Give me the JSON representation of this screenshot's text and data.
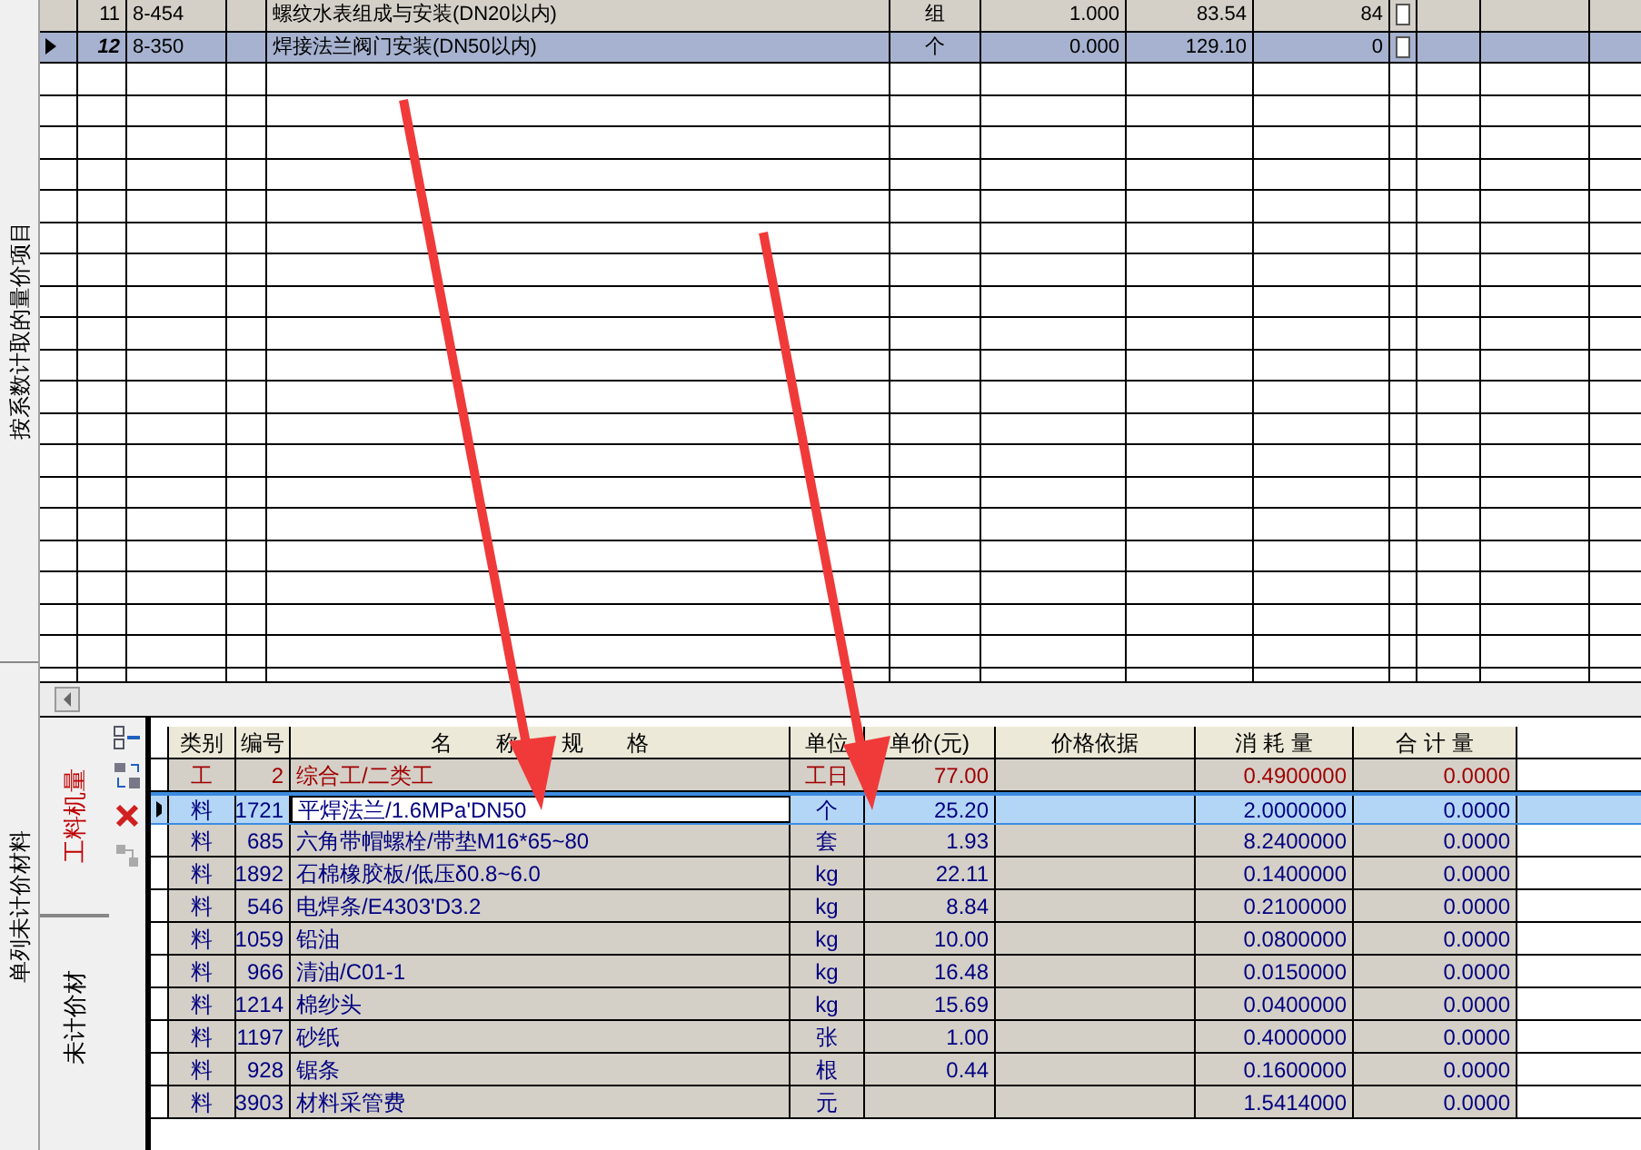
{
  "side_tabs": [
    {
      "label": "按系数计取的量价项目",
      "selected": false
    },
    {
      "label": "单列未计价材料",
      "selected": false
    }
  ],
  "top_grid": {
    "rows": [
      {
        "num": "11",
        "code": "8-454",
        "name": "螺纹水表组成与安装(DN20以内)",
        "unit": "组",
        "quantity": "1.000",
        "price": "83.54",
        "total": "84",
        "checked": false,
        "selected": false
      },
      {
        "num": "12",
        "code": "8-350",
        "name": "焊接法兰阀门安装(DN50以内)",
        "unit": "个",
        "quantity": "0.000",
        "price": "129.10",
        "total": "0",
        "checked": false,
        "selected": true
      }
    ]
  },
  "bottom_tabs": [
    {
      "label": "工料机量",
      "selected": true
    },
    {
      "label": "未计价材",
      "selected": false
    }
  ],
  "bottom_grid": {
    "columns": [
      "类别",
      "编号",
      "名　　称　　规　　格",
      "单位",
      "单价(元)",
      "价格依据",
      "消 耗 量",
      "合 计 量"
    ],
    "rows": [
      {
        "kind": "labor",
        "type": "工",
        "code": "2",
        "name": "综合工/二类工",
        "unit": "工日",
        "price": "77.00",
        "consumption": "0.4900000",
        "total": "0.0000",
        "selected": false
      },
      {
        "kind": "material",
        "type": "料",
        "code": "1721",
        "name": "平焊法兰/1.6MPa'DN50",
        "unit": "个",
        "price": "25.20",
        "consumption": "2.0000000",
        "total": "0.0000",
        "selected": true
      },
      {
        "kind": "material",
        "type": "料",
        "code": "685",
        "name": "六角带帽螺栓/带垫M16*65~80",
        "unit": "套",
        "price": "1.93",
        "consumption": "8.2400000",
        "total": "0.0000",
        "selected": false
      },
      {
        "kind": "material",
        "type": "料",
        "code": "1892",
        "name": "石棉橡胶板/低压δ0.8~6.0",
        "unit": "kg",
        "price": "22.11",
        "consumption": "0.1400000",
        "total": "0.0000",
        "selected": false
      },
      {
        "kind": "material",
        "type": "料",
        "code": "546",
        "name": "电焊条/E4303'D3.2",
        "unit": "kg",
        "price": "8.84",
        "consumption": "0.2100000",
        "total": "0.0000",
        "selected": false
      },
      {
        "kind": "material",
        "type": "料",
        "code": "1059",
        "name": "铅油",
        "unit": "kg",
        "price": "10.00",
        "consumption": "0.0800000",
        "total": "0.0000",
        "selected": false
      },
      {
        "kind": "material",
        "type": "料",
        "code": "966",
        "name": "清油/C01-1",
        "unit": "kg",
        "price": "16.48",
        "consumption": "0.0150000",
        "total": "0.0000",
        "selected": false
      },
      {
        "kind": "material",
        "type": "料",
        "code": "1214",
        "name": "棉纱头",
        "unit": "kg",
        "price": "15.69",
        "consumption": "0.0400000",
        "total": "0.0000",
        "selected": false
      },
      {
        "kind": "material",
        "type": "料",
        "code": "1197",
        "name": "砂纸",
        "unit": "张",
        "price": "1.00",
        "consumption": "0.4000000",
        "total": "0.0000",
        "selected": false
      },
      {
        "kind": "material",
        "type": "料",
        "code": "928",
        "name": "锯条",
        "unit": "根",
        "price": "0.44",
        "consumption": "0.1600000",
        "total": "0.0000",
        "selected": false
      },
      {
        "kind": "material",
        "type": "料",
        "code": "3903",
        "name": "材料采管费",
        "unit": "元",
        "price": "",
        "consumption": "1.5414000",
        "total": "0.0000",
        "selected": false
      }
    ]
  }
}
